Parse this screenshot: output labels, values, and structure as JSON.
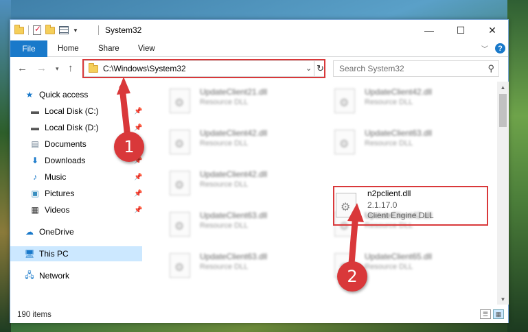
{
  "window": {
    "title": "System32",
    "controls": {
      "minimize": "—",
      "maximize": "☐",
      "close": "✕"
    }
  },
  "ribbon": {
    "tabs": [
      {
        "label": "File"
      },
      {
        "label": "Home"
      },
      {
        "label": "Share"
      },
      {
        "label": "View"
      }
    ]
  },
  "address": {
    "path": "C:\\Windows\\System32",
    "search_placeholder": "Search System32"
  },
  "navpane": {
    "items": [
      {
        "label": "Quick access",
        "icon": "star-icon"
      },
      {
        "label": "Local Disk (C:)",
        "icon": "drive-icon"
      },
      {
        "label": "Local Disk (D:)",
        "icon": "drive-icon"
      },
      {
        "label": "Documents",
        "icon": "documents-icon"
      },
      {
        "label": "Downloads",
        "icon": "downloads-icon"
      },
      {
        "label": "Music",
        "icon": "music-icon"
      },
      {
        "label": "Pictures",
        "icon": "pictures-icon"
      },
      {
        "label": "Videos",
        "icon": "videos-icon"
      },
      {
        "label": "OneDrive",
        "icon": "onedrive-icon"
      },
      {
        "label": "This PC",
        "icon": "pc-icon",
        "selected": true
      },
      {
        "label": "Network",
        "icon": "network-icon"
      }
    ]
  },
  "files": [
    {
      "name": "UpdateClient21.dll",
      "desc": "Resource DLL"
    },
    {
      "name": "UpdateClient42.dll",
      "desc": "Resource DLL"
    },
    {
      "name": "UpdateClient42.dll",
      "desc": "Resource DLL"
    },
    {
      "name": "UpdateClient63.dll",
      "desc": "Resource DLL"
    },
    {
      "name": "UpdateClient42.dll",
      "desc": "Resource DLL"
    },
    {
      "name": "UpdateClient63.dll",
      "desc": "Resource DLL"
    },
    {
      "name": "UpdateClient42.dll",
      "desc": "Resource DLL"
    },
    {
      "name": "UpdateClient63.dll",
      "desc": "Resource DLL"
    },
    {
      "name": "UpdateClient65.dll",
      "desc": "Resource DLL"
    }
  ],
  "highlighted_file": {
    "name": "n2pclient.dll",
    "version": "2.1.17.0",
    "description": "Client Engine DLL"
  },
  "status": {
    "item_count": "190 items"
  },
  "annotations": {
    "step1": "1",
    "step2": "2",
    "accent": "#d9383a"
  }
}
